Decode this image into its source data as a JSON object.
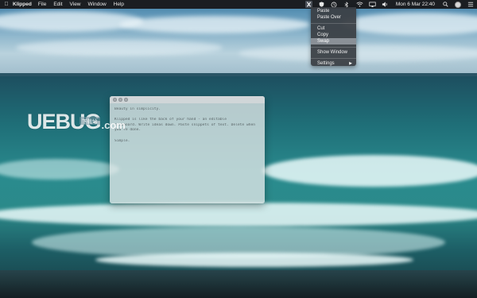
{
  "menubar": {
    "apple_icon": "apple-logo-icon",
    "app_name": "Klipped",
    "menus": [
      "File",
      "Edit",
      "View",
      "Window",
      "Help"
    ],
    "status_icons": [
      "klipped-icon",
      "shield-icon",
      "time-machine-icon",
      "bluetooth-icon",
      "wifi-icon",
      "airplay-display-icon",
      "volume-icon"
    ],
    "clock": "Mon 6 Mar  22:40",
    "trailing_icons": [
      "search-icon",
      "user-avatar-icon",
      "list-icon"
    ]
  },
  "dropdown": {
    "group1": [
      "Paste",
      "Paste Over"
    ],
    "group2": [
      "Cut",
      "Copy",
      "Swap"
    ],
    "highlighted": "Swap",
    "group3": [
      "Show Window"
    ],
    "group4": [
      "Settings"
    ]
  },
  "note": {
    "lines": [
      "Beauty in simplicity.",
      "",
      "Klipped is like the back of your hand - an editable",
      "clipboard. Write ideas down. Paste snippets of text. Delete when",
      "you're done.",
      "",
      "Simple."
    ]
  },
  "watermark": {
    "logo": "UEBUG",
    "sub": "下载站",
    "com": ".com"
  }
}
